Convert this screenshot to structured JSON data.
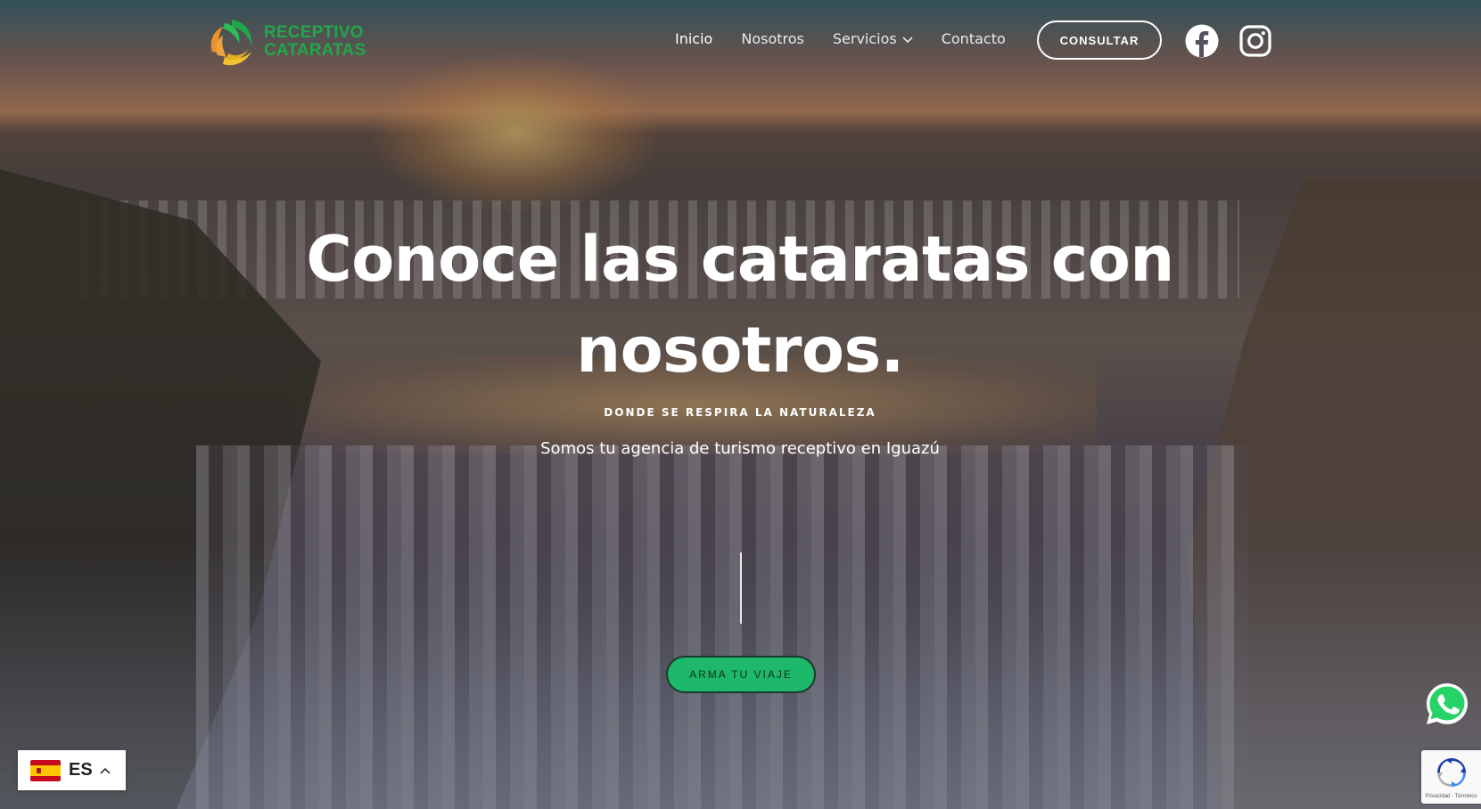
{
  "brand": {
    "line1": "RECEPTIVO",
    "line2": "CATARATAS"
  },
  "nav": {
    "items": [
      {
        "label": "Inicio",
        "active": true
      },
      {
        "label": "Nosotros"
      },
      {
        "label": "Servicios",
        "has_dropdown": true
      },
      {
        "label": "Contacto"
      }
    ],
    "cta": "CONSULTAR"
  },
  "social": {
    "facebook_icon": "facebook-icon",
    "instagram_icon": "instagram-icon"
  },
  "hero": {
    "title_line1": "Conoce las cataratas con",
    "title_line2": "nosotros.",
    "eyebrow": "DONDE SE RESPIRA LA NATURALEZA",
    "subtitle": "Somos tu agencia de turismo receptivo en Iguazú",
    "cta": "ARMA TU VIAJE"
  },
  "language": {
    "code": "ES",
    "flag": "spain-flag-icon"
  },
  "recaptcha": {
    "text": "Privacidad - Términos"
  },
  "colors": {
    "accent": "#1db86a",
    "brand_green": "#1fa84a",
    "brand_orange": "#e8912d",
    "brand_yellow": "#f2c230"
  }
}
